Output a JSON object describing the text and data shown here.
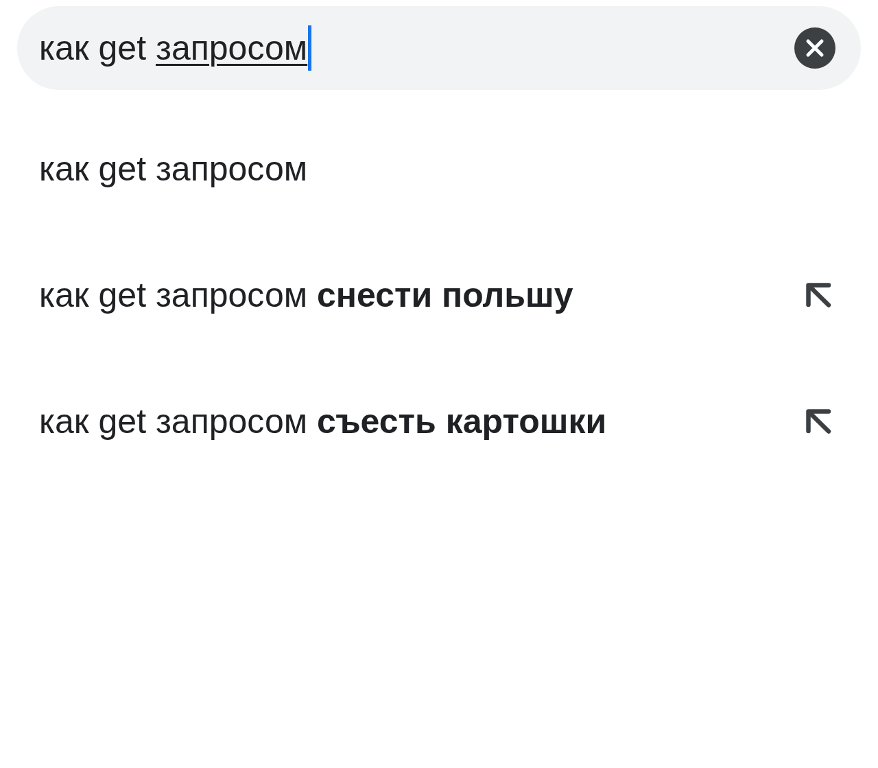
{
  "search": {
    "value_parts": [
      {
        "text": "как get",
        "composing": false
      },
      {
        "text": "запросом",
        "composing": true
      }
    ],
    "focused": true
  },
  "suggestions": [
    {
      "text": "как get запросом",
      "kind": "query"
    },
    {
      "text": "как get запросом **снести польшу**",
      "kind": "completion"
    },
    {
      "text": "как get запросом **съесть картошки**",
      "kind": "completion"
    }
  ]
}
